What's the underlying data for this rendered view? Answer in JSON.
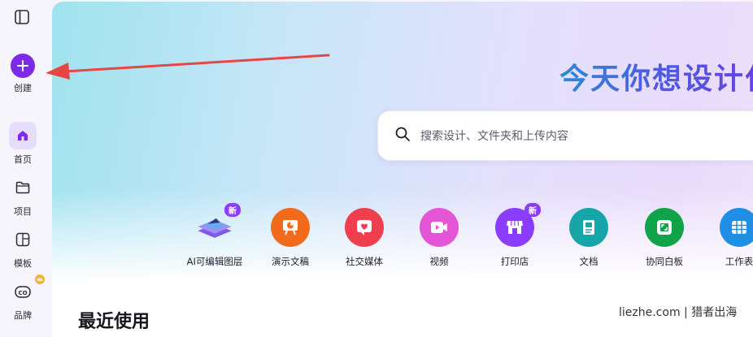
{
  "sidebar": {
    "create_label": "创建",
    "items": [
      {
        "label": "首页",
        "icon": "home-icon"
      },
      {
        "label": "项目",
        "icon": "folder-icon"
      },
      {
        "label": "模板",
        "icon": "template-icon"
      },
      {
        "label": "品牌",
        "icon": "brand-icon"
      }
    ]
  },
  "main": {
    "headline": "今天你想设计什",
    "search": {
      "placeholder": "搜索设计、文件夹和上传内容"
    },
    "tools": [
      {
        "label": "AI可编辑图层",
        "color": "#8b5cf6",
        "badge": "新"
      },
      {
        "label": "演示文稿",
        "color": "#f26a1b"
      },
      {
        "label": "社交媒体",
        "color": "#ef3f4f"
      },
      {
        "label": "视频",
        "color": "#e455d8"
      },
      {
        "label": "打印店",
        "color": "#8b3dff",
        "badge": "新"
      },
      {
        "label": "文档",
        "color": "#16a5a8"
      },
      {
        "label": "协同白板",
        "color": "#10a34a"
      },
      {
        "label": "工作表",
        "color": "#1f8fe6"
      }
    ],
    "recent_title": "最近使用",
    "watermark": "liezhe.com | 猎者出海"
  },
  "colors": {
    "accent": "#7d2ae8",
    "arrow": "#e84545"
  }
}
